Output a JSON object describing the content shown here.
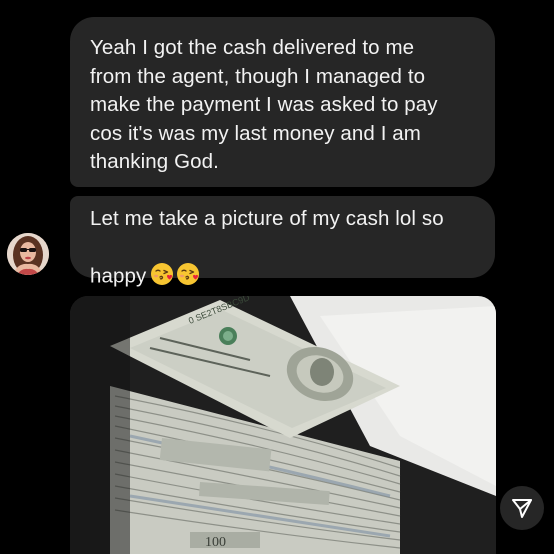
{
  "messages": [
    {
      "text": "Yeah I got the cash delivered to me\nfrom the agent, though I managed to\nmake the payment I was asked to pay\ncos it's was my last money and I am\nthanking God."
    },
    {
      "text": "Let me take a picture of my cash lol so\nhappy",
      "emojis": [
        "face-blowing-kiss",
        "face-blowing-kiss"
      ]
    }
  ],
  "photo": {
    "description": "cash-photo"
  },
  "colors": {
    "background": "#000000",
    "bubble": "#262626",
    "text": "#f2f2f2",
    "emoji": "#f7c531"
  },
  "icons": {
    "share": "paper-plane-icon"
  }
}
